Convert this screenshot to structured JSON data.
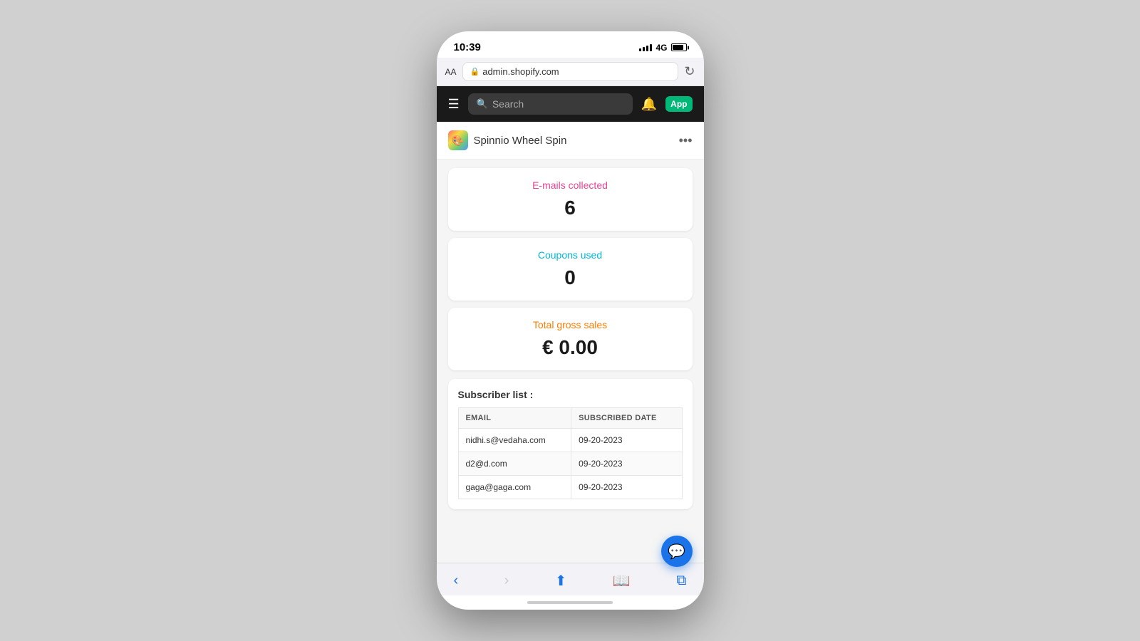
{
  "statusBar": {
    "time": "10:39",
    "signal": "4G"
  },
  "browserBar": {
    "fontSizeLabel": "AA",
    "url": "admin.shopify.com"
  },
  "shopifyNav": {
    "searchPlaceholder": "Search"
  },
  "appHeader": {
    "title": "Spinnio Wheel Spin",
    "appIconEmoji": "🎨"
  },
  "stats": {
    "emailsLabel": "E-mails collected",
    "emailsValue": "6",
    "couponsLabel": "Coupons used",
    "couponsValue": "0",
    "salesLabel": "Total gross sales",
    "salesValue": "€ 0.00"
  },
  "subscriberSection": {
    "title": "Subscriber list :",
    "tableHeaders": [
      "EMAIL",
      "SUBSCRIBED DATE"
    ],
    "rows": [
      {
        "email": "nidhi.s@vedaha.com",
        "date": "09-20-2023"
      },
      {
        "email": "d2@d.com",
        "date": "09-20-2023"
      },
      {
        "email": "gaga@gaga.com",
        "date": "09-20-2023"
      }
    ]
  }
}
